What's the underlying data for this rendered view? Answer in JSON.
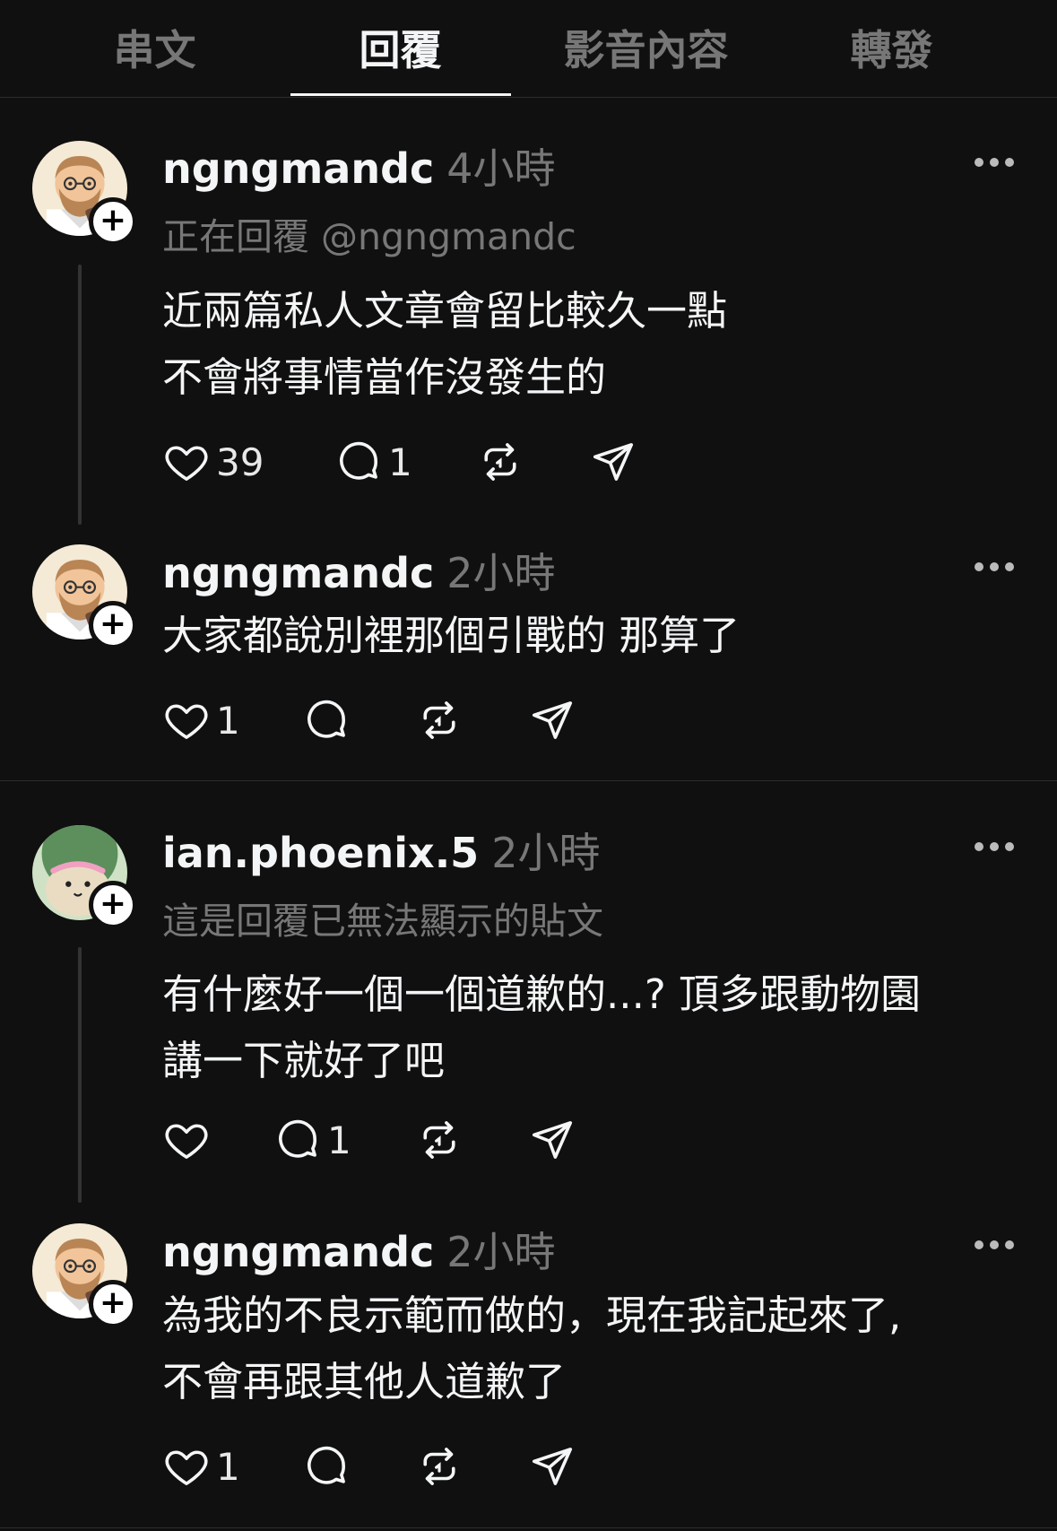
{
  "tabs": [
    {
      "label": "串文"
    },
    {
      "label": "回覆"
    },
    {
      "label": "影音內容"
    },
    {
      "label": "轉發"
    }
  ],
  "posts": [
    {
      "username": "ngngmandc",
      "time": "4小時",
      "subtitle": "正在回覆 @ngngmandc",
      "lines": [
        "近兩篇私人文章會留比較久一點",
        "不會將事情當作沒發生的"
      ],
      "likes": "39",
      "replies": "1"
    },
    {
      "username": "ngngmandc",
      "time": "2小時",
      "lines": [
        "大家都說別裡那個引戰的 那算了"
      ],
      "likes": "1",
      "replies": ""
    },
    {
      "username": "ian.phoenix.5",
      "time": "2小時",
      "subtitle": "這是回覆已無法顯示的貼文",
      "lines": [
        "有什麼好一個一個道歉的...? 頂多跟動物園",
        "講一下就好了吧"
      ],
      "likes": "",
      "replies": "1"
    },
    {
      "username": "ngngmandc",
      "time": "2小時",
      "lines": [
        "為我的不良示範而做的，現在我記起來了,",
        "不會再跟其他人道歉了"
      ],
      "likes": "1",
      "replies": ""
    }
  ],
  "icons": {
    "plus": "+",
    "like": "heart-icon",
    "reply": "comment-icon",
    "repost": "repost-icon",
    "share": "send-icon",
    "more": "more-icon"
  },
  "colors": {
    "background": "#101010",
    "text": "#f3f5f7",
    "muted": "#777777"
  }
}
